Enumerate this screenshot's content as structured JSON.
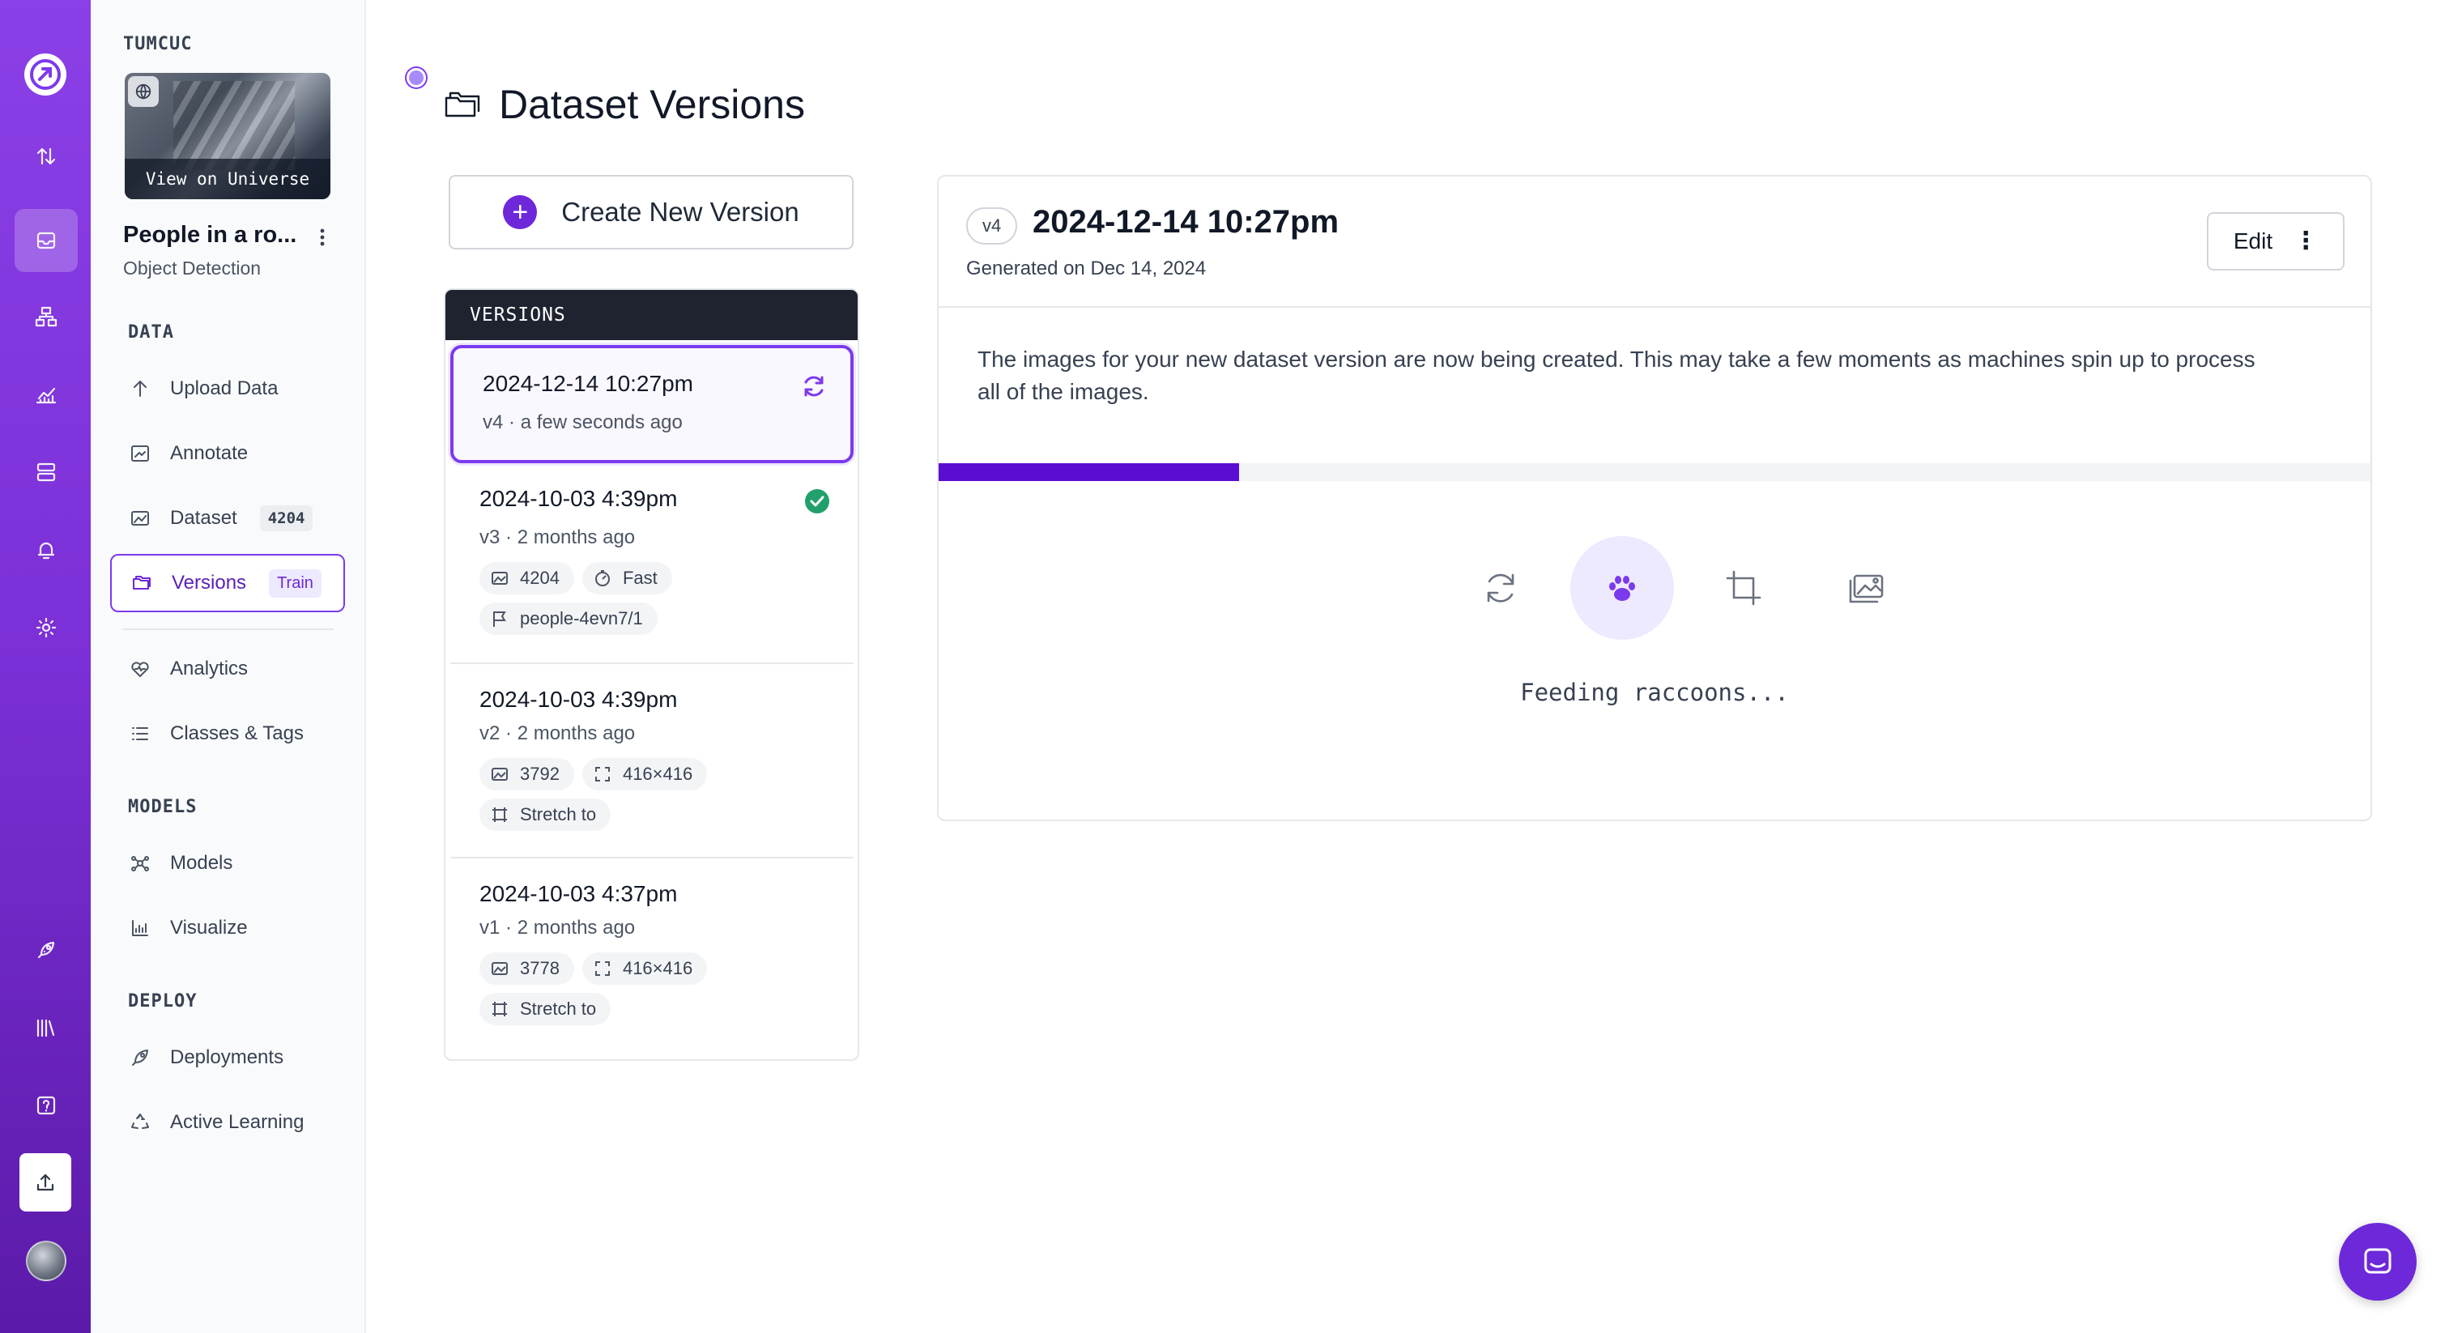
{
  "rail": {
    "icons": [
      "roboflow-logo-icon",
      "transfer-icon",
      "inbox-icon",
      "workflow-icon",
      "chart-icon",
      "server-icon",
      "bell-icon",
      "gear-icon",
      "rocket-icon",
      "library-icon",
      "help-icon",
      "upload-icon",
      "avatar"
    ]
  },
  "sidebar": {
    "workspace": "TUMCUC",
    "thumbnail_label": "View on Universe",
    "project_name": "People in a ro...",
    "project_type": "Object Detection",
    "sections": {
      "data": "DATA",
      "models": "MODELS",
      "deploy": "DEPLOY"
    },
    "items": {
      "upload": "Upload Data",
      "annotate": "Annotate",
      "dataset": "Dataset",
      "dataset_count": "4204",
      "versions": "Versions",
      "versions_pill": "Train",
      "analytics": "Analytics",
      "classes": "Classes & Tags",
      "models": "Models",
      "visualize": "Visualize",
      "deployments": "Deployments",
      "active_learning": "Active Learning"
    }
  },
  "main": {
    "title": "Dataset Versions",
    "create_button": "Create New Version",
    "versions_header": "VERSIONS",
    "versions": [
      {
        "date": "2024-12-14 10:27pm",
        "tag": "v4",
        "age": "a few seconds ago",
        "status": "generating"
      },
      {
        "date": "2024-10-03 4:39pm",
        "tag": "v3",
        "age": "2 months ago",
        "status": "done",
        "chips": [
          {
            "icon": "image-icon",
            "text": "4204"
          },
          {
            "icon": "timer-icon",
            "text": "Fast"
          },
          {
            "icon": "flag-icon",
            "text": "people-4evn7/1"
          }
        ]
      },
      {
        "date": "2024-10-03 4:39pm",
        "tag": "v2",
        "age": "2 months ago",
        "chips": [
          {
            "icon": "image-icon",
            "text": "3792"
          },
          {
            "icon": "resize-icon",
            "text": "416×416"
          },
          {
            "icon": "crop-icon",
            "text": "Stretch to"
          }
        ]
      },
      {
        "date": "2024-10-03 4:37pm",
        "tag": "v1",
        "age": "2 months ago",
        "chips": [
          {
            "icon": "image-icon",
            "text": "3778"
          },
          {
            "icon": "resize-icon",
            "text": "416×416"
          },
          {
            "icon": "crop-icon",
            "text": "Stretch to"
          }
        ]
      }
    ],
    "separator": "·"
  },
  "detail": {
    "tag": "v4",
    "title": "2024-12-14 10:27pm",
    "generated": "Generated on Dec 14, 2024",
    "edit_label": "Edit",
    "message": "The images for your new dataset version are now being created. This may take a few moments as machines spin up to process all of the images.",
    "progress_fraction": 0.21,
    "steps": [
      "refresh-icon",
      "paw-icon",
      "crop-icon",
      "images-icon"
    ],
    "active_step": 1,
    "status_text": "Feeding raccoons..."
  },
  "colors": {
    "accent": "#7c3aed",
    "progress": "#5b0ed1",
    "success": "#22a06b",
    "rail_top": "#8b3fe6",
    "rail_bottom": "#5b1aa8"
  }
}
